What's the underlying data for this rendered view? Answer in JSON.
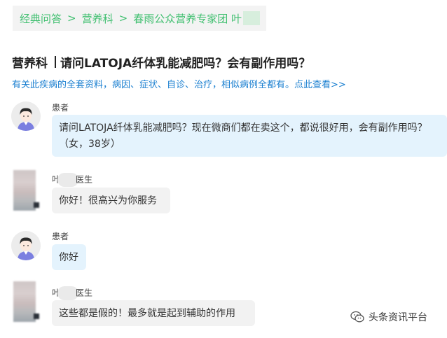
{
  "breadcrumb": {
    "items": [
      "经典问答",
      "营养科",
      "春雨公众营养专家团 叶"
    ],
    "separator": ">"
  },
  "question": {
    "department": "营养科",
    "title": "请问LATOJA纤体乳能减肥吗？会有副作用吗？"
  },
  "info_link": "有关此疾病的全套资料，病因、症状、自诊、治疗，相似病例全都有。点此查看>>",
  "conversation": [
    {
      "role": "patient",
      "speaker": "患者",
      "text": "请问LATOJA纤体乳能减肥吗？现在微商们都在卖这个，都说很好用，会有副作用吗？（女，38岁）"
    },
    {
      "role": "doctor",
      "speaker_prefix": "叶",
      "speaker_suffix": "医生",
      "text": "你好！很高兴为你服务"
    },
    {
      "role": "patient",
      "speaker": "患者",
      "text": "你好"
    },
    {
      "role": "doctor",
      "speaker_prefix": "叶",
      "speaker_suffix": "医生",
      "text": "这些都是假的！最多就是起到辅助的作用"
    }
  ],
  "watermark": "头条资讯平台",
  "colors": {
    "breadcrumb_text": "#3fbf6f",
    "link": "#1a7fd0",
    "patient_bubble": "#e4f3fd",
    "doctor_bubble": "#f2f2f2"
  }
}
